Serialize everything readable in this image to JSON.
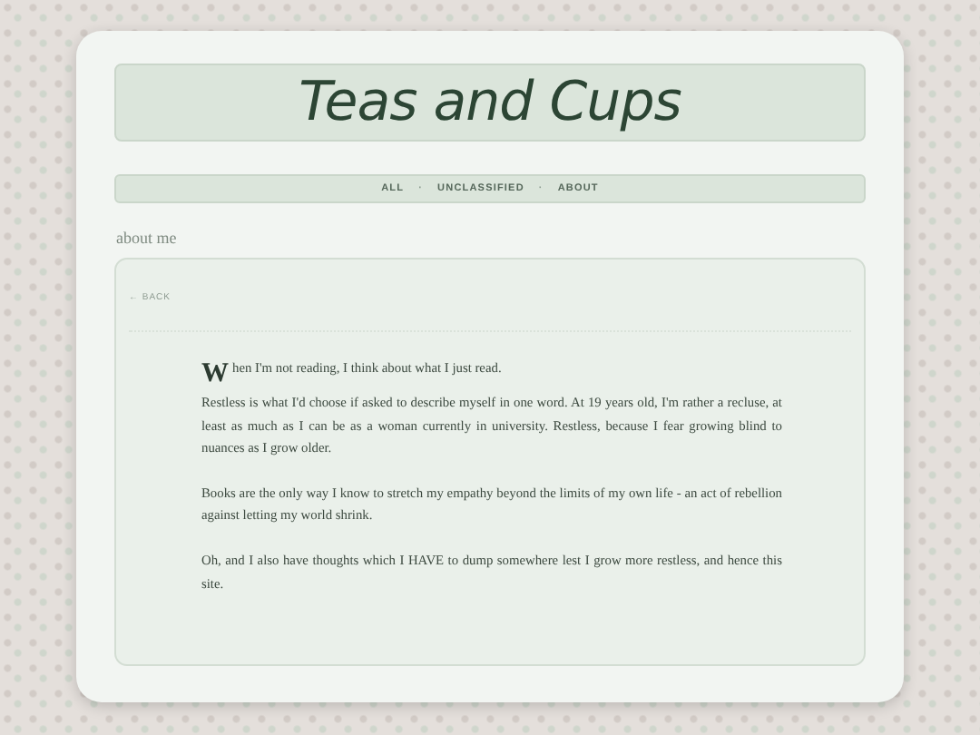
{
  "header": {
    "title": "Teas and Cups"
  },
  "nav": {
    "separator": "·",
    "items": [
      {
        "label": "ALL"
      },
      {
        "label": "UNCLASSIFIED"
      },
      {
        "label": "ABOUT"
      }
    ]
  },
  "page_title": "about me",
  "post": {
    "back_link": "← BACK",
    "paragraphs": [
      {
        "text": "When I'm not reading, I think about what I just read.",
        "drop_cap": true
      },
      {
        "text": "Restless is what I'd choose if asked to describe myself in one word. At 19 years old, I'm rather a recluse, at least as much as I can be as a woman currently in university. Restless, because I fear growing blind to nuances as I grow older.",
        "drop_cap": false
      },
      {
        "text": "Books are the only way I know to stretch my empathy beyond the limits of my own life - an act of rebellion against letting my world shrink.",
        "drop_cap": false
      },
      {
        "text": "Oh, and I also have thoughts which I HAVE to dump somewhere lest I grow more restless, and hence this site.",
        "drop_cap": false
      }
    ]
  }
}
